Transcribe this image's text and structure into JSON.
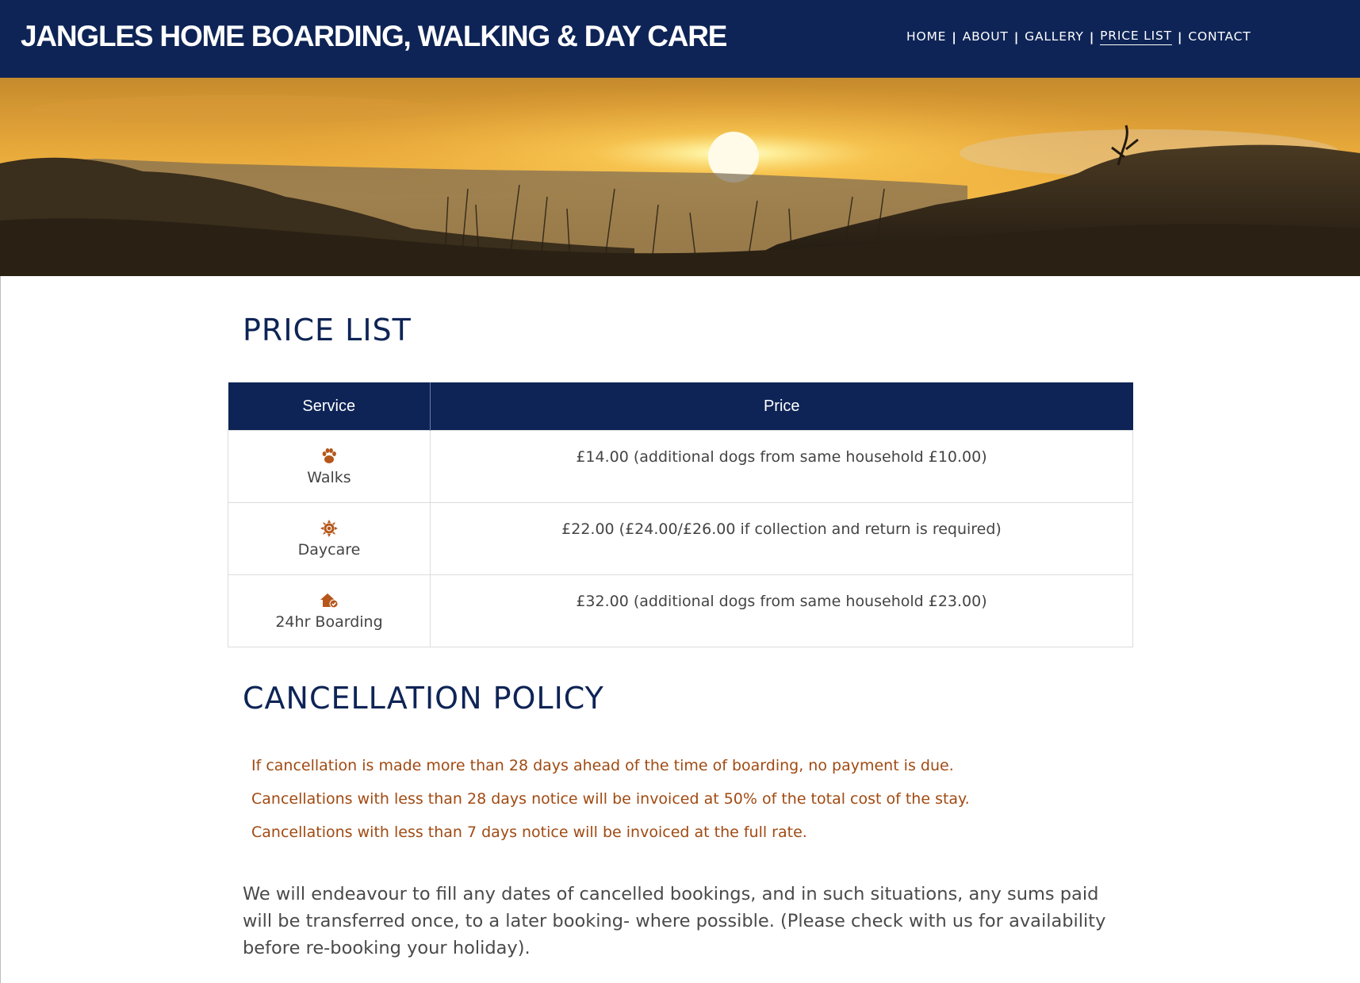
{
  "header": {
    "title": "JANGLES HOME BOARDING, WALKING & DAY CARE",
    "nav": [
      {
        "label": "HOME",
        "active": false
      },
      {
        "label": "ABOUT",
        "active": false
      },
      {
        "label": "GALLERY",
        "active": false
      },
      {
        "label": "PRICE LIST",
        "active": true
      },
      {
        "label": "CONTACT",
        "active": false
      }
    ],
    "separator": "|"
  },
  "hero": {
    "image": "sunset-over-moorland"
  },
  "price_list": {
    "heading": "PRICE LIST",
    "columns": [
      "Service",
      "Price"
    ],
    "rows": [
      {
        "icon": "paw-icon",
        "service": "Walks",
        "price": "£14.00 (additional dogs from same household £10.00)"
      },
      {
        "icon": "sun-icon",
        "service": "Daycare",
        "price": "£22.00 (£24.00/£26.00 if collection and return is required)"
      },
      {
        "icon": "home-check-icon",
        "service": "24hr Boarding",
        "price": "£32.00 (additional dogs from same household £23.00)"
      }
    ]
  },
  "cancellation": {
    "heading": "CANCELLATION POLICY",
    "rules": [
      "If cancellation is made more than 28 days ahead of the time of boarding, no payment is due.",
      "Cancellations with less than 28 days notice will be invoiced at 50% of the total cost of the stay.",
      "Cancellations with less than 7 days notice will be invoiced at the full rate."
    ],
    "note": "We will endeavour to fill any dates of cancelled bookings, and in such situations, any sums paid will be transferred once, to a later booking- where possible. (Please check with us for availability before re-booking your holiday)."
  },
  "colors": {
    "navy": "#0e2456",
    "accent_orange": "#a04a12",
    "icon_orange": "#b5561a"
  }
}
